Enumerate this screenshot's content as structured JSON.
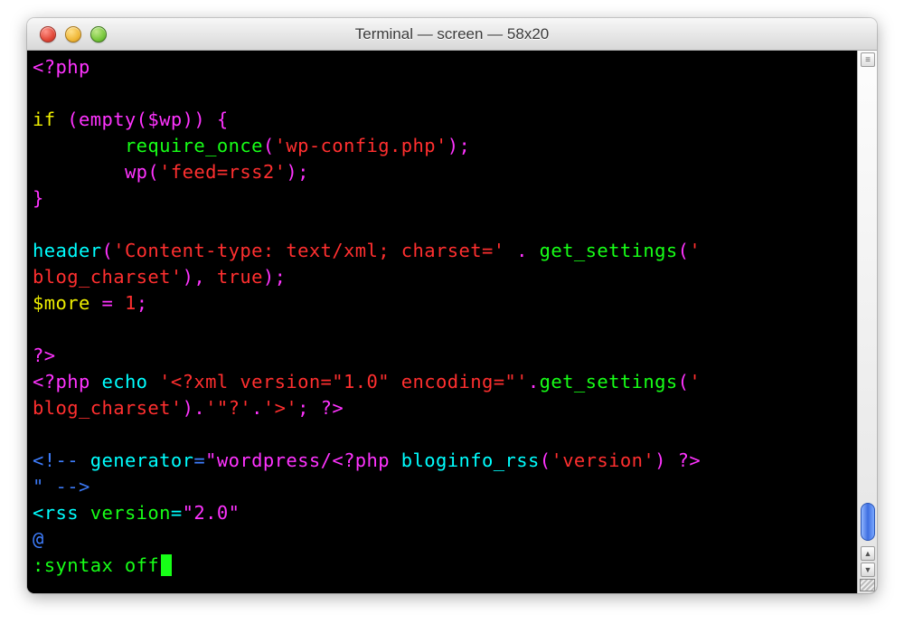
{
  "window": {
    "title": "Terminal — screen — 58x20"
  },
  "code": {
    "l1_open": "<?php",
    "l2": "",
    "l3_if": "if",
    "l3_rest": " (empty($wp)) {",
    "l4_indent": "        ",
    "l4_fn": "require_once",
    "l4_p1": "(",
    "l4_str": "'wp-config.php'",
    "l4_p2": ");",
    "l5_indent": "        ",
    "l5_fn": "wp(",
    "l5_str": "'feed=rss2'",
    "l5_end": ");",
    "l6_brace": "}",
    "l7": "",
    "l8_fn": "header",
    "l8_p1": "(",
    "l8_str1": "'Content-type: text/xml; charset='",
    "l8_dot": " . ",
    "l8_fn2": "get_settings",
    "l8_p2": "(",
    "l8_str2": "'",
    "l9_str": "blog_charset'",
    "l9_mid": "), ",
    "l9_true": "true",
    "l9_end": ");",
    "l10_var": "$more",
    "l10_eq": " = ",
    "l10_num": "1",
    "l10_semi": ";",
    "l11": "",
    "l12_close": "?>",
    "l13_open": "<?php",
    "l13_echo": " echo ",
    "l13_str1": "'<?xml version=\"1.0\" encoding=\"'",
    "l13_dot": ".",
    "l13_fn": "get_settings",
    "l13_p": "(",
    "l13_str2": "'",
    "l14_str1": "blog_charset'",
    "l14_mid": ").",
    "l14_str2": "'\"?'",
    "l14_dot2": ".",
    "l14_str3": "'>'",
    "l14_end": "; ?>",
    "l15": "",
    "l16_cmt1": "<!-- ",
    "l16_gen": "generator",
    "l16_eq": "=",
    "l16_gv": "\"wordpress/",
    "l16_php": "<?php",
    "l16_sp": " ",
    "l16_fn": "bloginfo_rss",
    "l16_p1": "(",
    "l16_str": "'version'",
    "l16_p2": ")",
    "l16_close": " ?>",
    "l17_cmt2": "\" -->",
    "l18_tag": "<rss",
    "l18_sp": " ",
    "l18_attr": "version",
    "l18_eq": "=",
    "l18_val": "\"2.0\"",
    "l19_at": "@",
    "cmd": ":syntax off"
  }
}
